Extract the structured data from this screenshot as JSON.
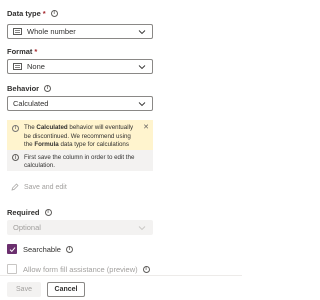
{
  "data_type": {
    "label": "Data type",
    "required_marker": "*",
    "value": "Whole number"
  },
  "format": {
    "label": "Format",
    "required_marker": "*",
    "value": "None"
  },
  "behavior": {
    "label": "Behavior",
    "value": "Calculated"
  },
  "warning": {
    "text_before": "The ",
    "bold_word": "Calculated",
    "text_middle": " behavior will eventually be discontinued. We recommend using the ",
    "bold_word2": "Formula",
    "text_after": " data type for calculations instead."
  },
  "note": {
    "text": "First save the column in order to edit the calculation."
  },
  "save_and_edit": {
    "label": "Save and edit"
  },
  "required": {
    "label": "Required",
    "value": "Optional"
  },
  "searchable": {
    "label": "Searchable",
    "checked": true
  },
  "form_fill": {
    "label": "Allow form fill assistance (preview)",
    "checked": false
  },
  "footer": {
    "save_label": "Save",
    "cancel_label": "Cancel"
  },
  "colors": {
    "accent": "#6b2f6e",
    "warning_bg": "#fff4ce",
    "required": "#a4262c"
  }
}
